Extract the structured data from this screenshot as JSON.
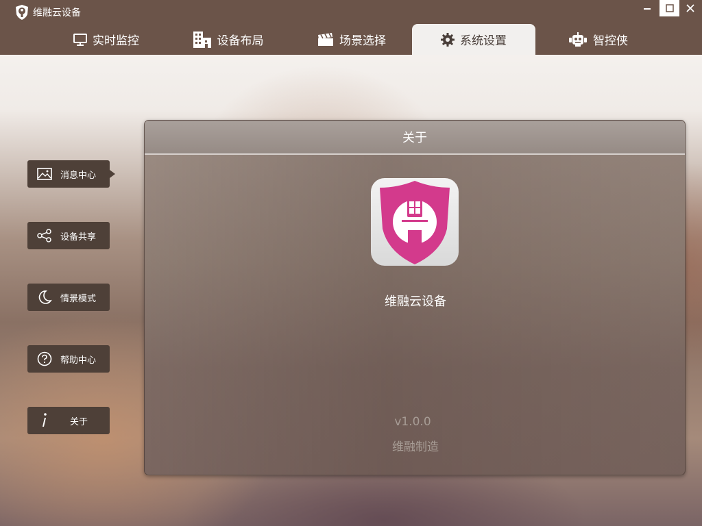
{
  "app": {
    "title": "维融云设备"
  },
  "nav": {
    "tabs": [
      {
        "label": "实时监控",
        "icon": "monitor-icon",
        "active": false
      },
      {
        "label": "设备布局",
        "icon": "building-icon",
        "active": false
      },
      {
        "label": "场景选择",
        "icon": "clapperboard-icon",
        "active": false
      },
      {
        "label": "系统设置",
        "icon": "gear-icon",
        "active": true
      },
      {
        "label": "智控侠",
        "icon": "robot-icon",
        "active": false
      }
    ]
  },
  "sidebar": {
    "items": [
      {
        "label": "消息中心",
        "icon": "image-icon",
        "active": true
      },
      {
        "label": "设备共享",
        "icon": "share-icon",
        "active": false
      },
      {
        "label": "情景模式",
        "icon": "moon-icon",
        "active": false
      },
      {
        "label": "帮助中心",
        "icon": "question-icon",
        "active": false
      },
      {
        "label": "关于",
        "icon": "info-icon",
        "active": false
      }
    ]
  },
  "panel": {
    "title": "关于",
    "app_name": "维融云设备",
    "version": "v1.0.0",
    "maker": "维融制造"
  },
  "colors": {
    "topbar": "#6b5449",
    "sidebar_button": "#4e4038",
    "brand_pink": "#d33a8c"
  }
}
